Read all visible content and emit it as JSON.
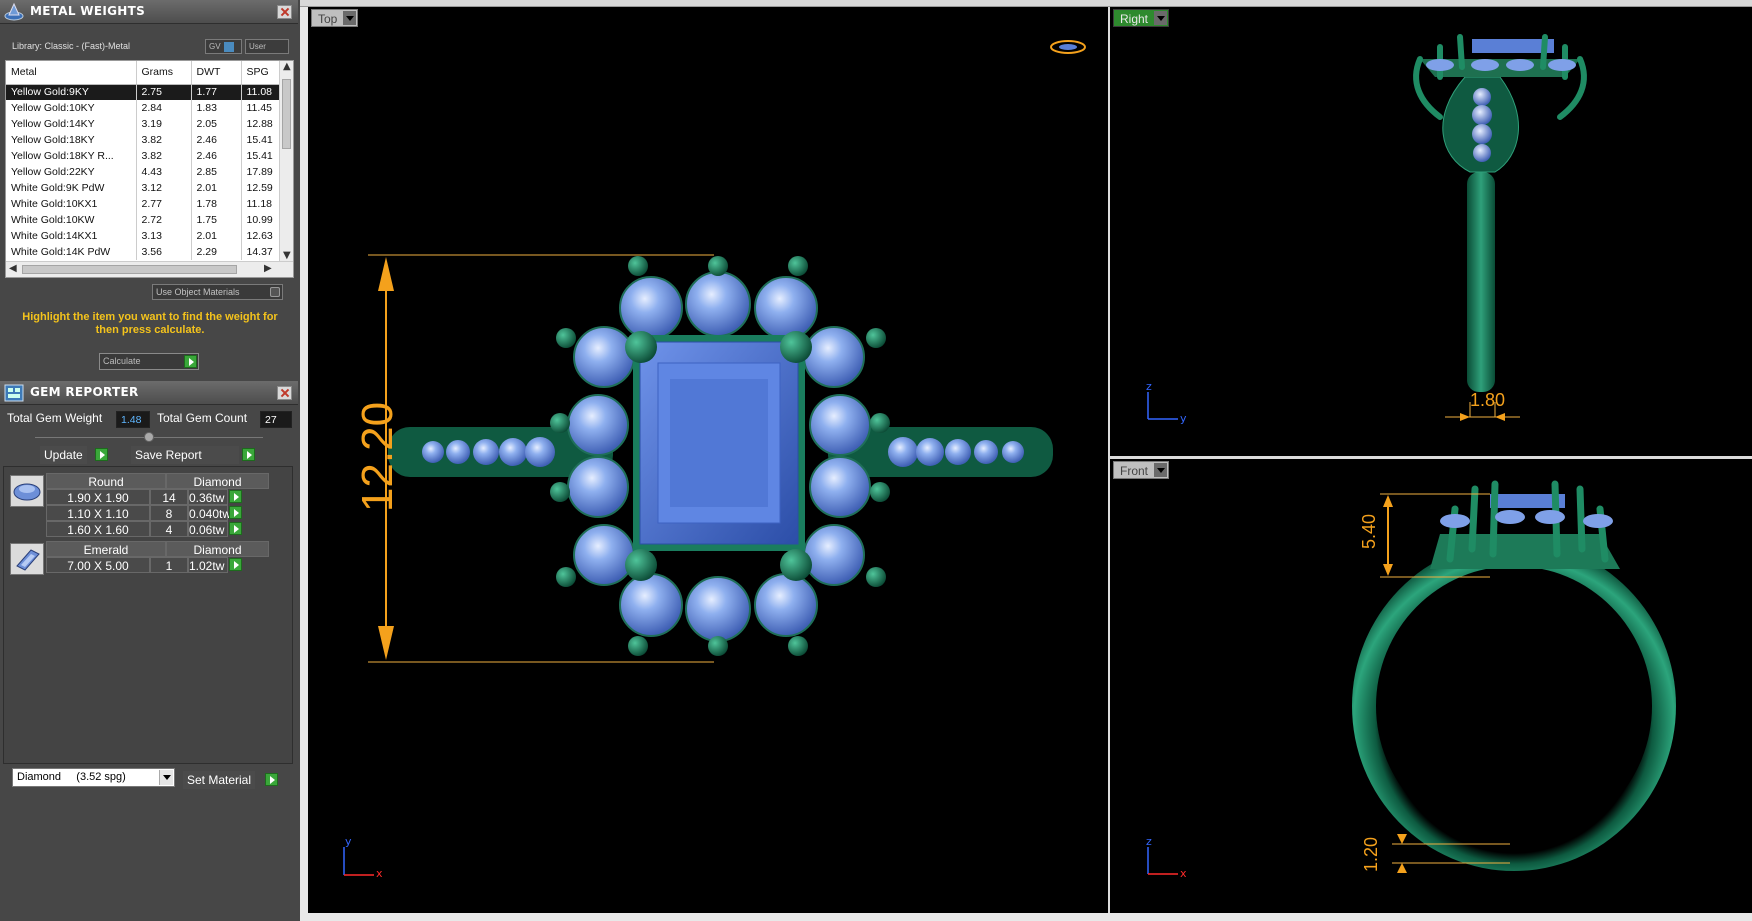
{
  "colors": {
    "accent": "#f4c31c",
    "metal_green": "#1f7a5c",
    "gem_blue": "#5a7fd6",
    "selection": "#1b1b1b"
  },
  "metal_weights": {
    "title": "METAL WEIGHTS",
    "library": "Library: Classic - (Fast)-Metal",
    "chip_gv": "GV",
    "chip_user": "User",
    "columns": [
      "Metal",
      "Grams",
      "DWT",
      "SPG"
    ],
    "rows": [
      [
        "Yellow Gold:9KY",
        "2.75",
        "1.77",
        "11.08"
      ],
      [
        "Yellow Gold:10KY",
        "2.84",
        "1.83",
        "11.45"
      ],
      [
        "Yellow Gold:14KY",
        "3.19",
        "2.05",
        "12.88"
      ],
      [
        "Yellow Gold:18KY",
        "3.82",
        "2.46",
        "15.41"
      ],
      [
        "Yellow Gold:18KY R...",
        "3.82",
        "2.46",
        "15.41"
      ],
      [
        "Yellow Gold:22KY",
        "4.43",
        "2.85",
        "17.89"
      ],
      [
        "White Gold:9K PdW",
        "3.12",
        "2.01",
        "12.59"
      ],
      [
        "White Gold:10KX1",
        "2.77",
        "1.78",
        "11.18"
      ],
      [
        "White Gold:10KW",
        "2.72",
        "1.75",
        "10.99"
      ],
      [
        "White Gold:14KX1",
        "3.13",
        "2.01",
        "12.63"
      ],
      [
        "White Gold:14K PdW",
        "3.56",
        "2.29",
        "14.37"
      ]
    ],
    "use_object_materials": "Use Object Materials",
    "hint": "Highlight the item you want to find the weight for then press calculate.",
    "calculate": "Calculate"
  },
  "gem_reporter": {
    "title": "GEM REPORTER",
    "total_weight_label": "Total Gem Weight",
    "total_weight": "1.48",
    "total_count_label": "Total Gem Count",
    "total_count": "27",
    "update": "Update",
    "save_report": "Save Report",
    "groups": [
      {
        "shape": "Round",
        "material": "Diamond",
        "icon": "round-gem-icon",
        "rows": [
          [
            "1.90 X 1.90",
            "14",
            "0.36tw"
          ],
          [
            "1.10 X 1.10",
            "8",
            "0.040tw"
          ],
          [
            "1.60 X 1.60",
            "4",
            "0.06tw"
          ]
        ]
      },
      {
        "shape": "Emerald",
        "material": "Diamond",
        "icon": "emerald-gem-icon",
        "rows": [
          [
            "7.00 X 5.00",
            "1",
            "1.02tw"
          ]
        ]
      }
    ],
    "material_select": "Diamond     (3.52 spg)",
    "set_material": "Set Material"
  },
  "viewports": {
    "top": {
      "label": "Top",
      "dimension": "12.20",
      "axis_y": "y",
      "axis_x": "x"
    },
    "right": {
      "label": "Right",
      "dimension": "1.80",
      "axis_z": "z",
      "axis_y": "y"
    },
    "front": {
      "label": "Front",
      "dimension_top": "5.40",
      "dimension_bottom": "1.20",
      "axis_z": "z",
      "axis_x": "x"
    }
  }
}
